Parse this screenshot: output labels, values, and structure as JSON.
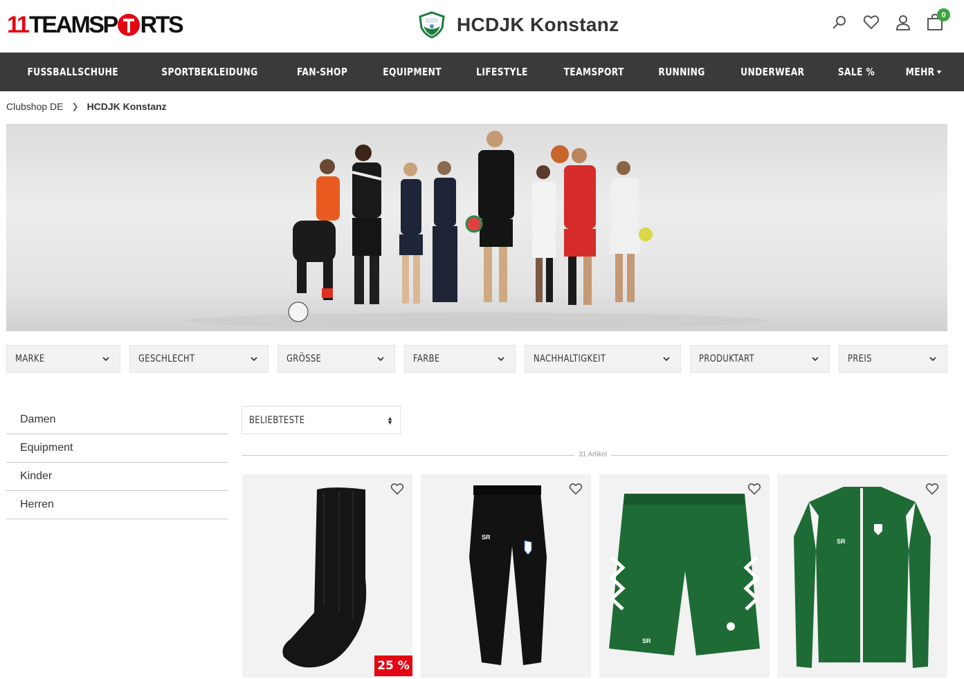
{
  "header": {
    "logo_text_prefix": "11",
    "logo_text_a": "TEAMSP",
    "logo_text_b": "RTS",
    "club_name": "HCDJK Konstanz",
    "cart_count": "0"
  },
  "nav": {
    "items": [
      "FUSSBALLSCHUHE",
      "SPORTBEKLEIDUNG",
      "FAN-SHOP",
      "EQUIPMENT",
      "LIFESTYLE",
      "TEAMSPORT",
      "RUNNING",
      "UNDERWEAR",
      "SALE %",
      "MEHR"
    ]
  },
  "breadcrumb": {
    "root": "Clubshop DE",
    "current": "HCDJK Konstanz"
  },
  "filters": [
    "MARKE",
    "GESCHLECHT",
    "GRÖSSE",
    "FARBE",
    "NACHHALTIGKEIT",
    "PRODUKTART",
    "PREIS"
  ],
  "sidebar": {
    "items": [
      "Damen",
      "Equipment",
      "Kinder",
      "Herren"
    ]
  },
  "sort": {
    "selected": "BELIEBTESTE"
  },
  "results": {
    "count_text": "31 Artikel"
  },
  "products": [
    {
      "image": "black-sock",
      "discount": "25 %"
    },
    {
      "image": "black-pants",
      "print": "SR"
    },
    {
      "image": "green-shorts",
      "print": "SR"
    },
    {
      "image": "green-jacket",
      "print": "SR"
    }
  ],
  "colors": {
    "brand_red": "#e30613",
    "nav_bg": "#3a3a3a",
    "cart_badge": "#3aa53a",
    "club_green": "#1e7a3c"
  }
}
